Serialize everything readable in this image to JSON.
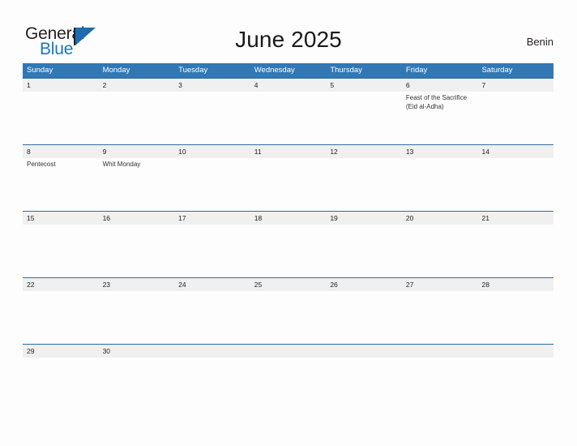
{
  "brand": {
    "name_part1": "General",
    "name_part2": "Blue",
    "triangle_icon": "triangle-icon",
    "color_dark": "#231f20",
    "color_blue": "#1b76bc"
  },
  "header": {
    "title": "June 2025",
    "country": "Benin"
  },
  "theme": {
    "header_blue": "#3178b5",
    "row_border": "#2e6da4",
    "date_band": "#f0f0f0",
    "page_bg": "#fdfdfd"
  },
  "calendar": {
    "weekday_headers": [
      "Sunday",
      "Monday",
      "Tuesday",
      "Wednesday",
      "Thursday",
      "Friday",
      "Saturday"
    ],
    "weeks": [
      {
        "size": "tall",
        "days": [
          {
            "num": "1",
            "event": ""
          },
          {
            "num": "2",
            "event": ""
          },
          {
            "num": "3",
            "event": ""
          },
          {
            "num": "4",
            "event": ""
          },
          {
            "num": "5",
            "event": ""
          },
          {
            "num": "6",
            "event": "Feast of the Sacrifice (Eid al-Adha)"
          },
          {
            "num": "7",
            "event": ""
          }
        ]
      },
      {
        "size": "tall",
        "days": [
          {
            "num": "8",
            "event": "Pentecost"
          },
          {
            "num": "9",
            "event": "Whit Monday"
          },
          {
            "num": "10",
            "event": ""
          },
          {
            "num": "11",
            "event": ""
          },
          {
            "num": "12",
            "event": ""
          },
          {
            "num": "13",
            "event": ""
          },
          {
            "num": "14",
            "event": ""
          }
        ]
      },
      {
        "size": "tall",
        "days": [
          {
            "num": "15",
            "event": ""
          },
          {
            "num": "16",
            "event": ""
          },
          {
            "num": "17",
            "event": ""
          },
          {
            "num": "18",
            "event": ""
          },
          {
            "num": "19",
            "event": ""
          },
          {
            "num": "20",
            "event": ""
          },
          {
            "num": "21",
            "event": ""
          }
        ]
      },
      {
        "size": "tall",
        "days": [
          {
            "num": "22",
            "event": ""
          },
          {
            "num": "23",
            "event": ""
          },
          {
            "num": "24",
            "event": ""
          },
          {
            "num": "25",
            "event": ""
          },
          {
            "num": "26",
            "event": ""
          },
          {
            "num": "27",
            "event": ""
          },
          {
            "num": "28",
            "event": ""
          }
        ]
      },
      {
        "size": "short",
        "days": [
          {
            "num": "29",
            "event": ""
          },
          {
            "num": "30",
            "event": ""
          },
          {
            "num": "",
            "event": ""
          },
          {
            "num": "",
            "event": ""
          },
          {
            "num": "",
            "event": ""
          },
          {
            "num": "",
            "event": ""
          },
          {
            "num": "",
            "event": ""
          }
        ]
      }
    ]
  }
}
